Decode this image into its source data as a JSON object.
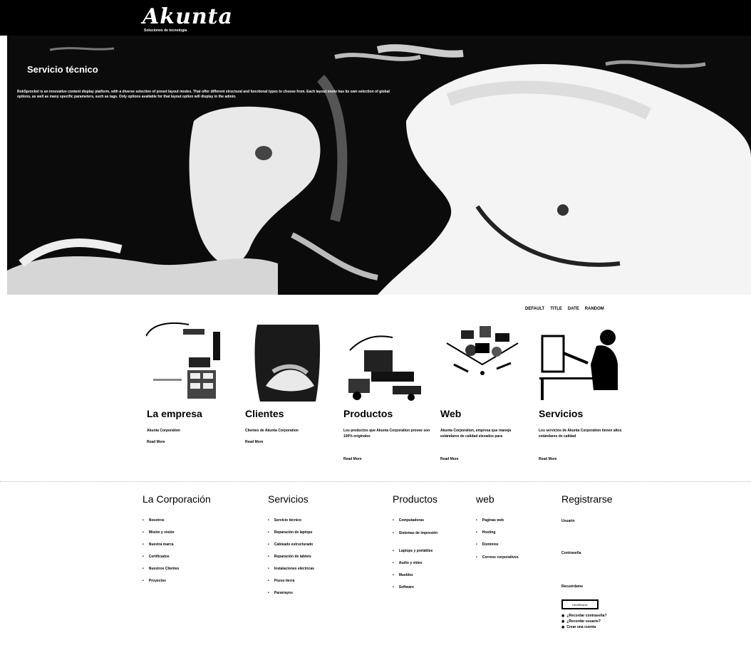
{
  "header": {
    "logo_text": "Akunta",
    "tagline": "Soluciones de tecnología"
  },
  "hero": {
    "title": "Servicio técnico",
    "text": "RokSprocket is an innovative content display platform, with a diverse selection of preset layout modes. That offer different structural and functional types to choose from. Each layout mode has its own selection of global options, as well as many specific parameters, such as tags. Only options available for that layout option will display in the admin."
  },
  "layout_switch": [
    "DEFAULT",
    "TITLE",
    "DATE",
    "RANDOM"
  ],
  "features": [
    {
      "title": "La empresa",
      "desc": "Akunta Corporation",
      "more": "Read More"
    },
    {
      "title": "Clientes",
      "desc": "Clientes de Akunta Corporation",
      "more": "Read More"
    },
    {
      "title": "Productos",
      "desc": "Los productos que Akunta Corporation provee son 100% originales",
      "more": "Read More"
    },
    {
      "title": "Web",
      "desc": "Akunta Corporation, empresa que maneja estándares de calidad elevados para",
      "more": "Read More"
    },
    {
      "title": "Servicios",
      "desc": "Los servicios de Akunta Corporation tienen altos estándares de calidad",
      "more": "Read More"
    }
  ],
  "footer": {
    "corporacion": {
      "title": "La Corporación",
      "items": [
        "Nosotros",
        "Misión y visión",
        "Nuestra marca",
        "Certificados",
        "Nuestros Clientes",
        "Proyectos"
      ]
    },
    "servicios": {
      "title": "Servicios",
      "items": [
        "Servicio técnico",
        "Reparación de laptops",
        "Cableado estructurado",
        "Reparación de tablets",
        "Instalaciones eléctricas",
        "Pozos tierra",
        "Pararrayos"
      ]
    },
    "productos": {
      "title": "Productos",
      "items": [
        "Computadoras",
        "Sistemas de impresión",
        "Laptops y portátiles",
        "Audio y video",
        "Muebles",
        "Software"
      ]
    },
    "web": {
      "title": "web",
      "items": [
        "Paginas web",
        "Hosting",
        "Dominios",
        "Correos corporativos"
      ]
    },
    "registrarse": {
      "title": "Registrarse",
      "user_label": "Usuario",
      "pass_label": "Contraseña",
      "remember_label": "Recuérdame",
      "button_label": "Identificarse",
      "links": [
        "¿Recordar contraseña?",
        "¿Recordar usuario?",
        "Crear una cuenta"
      ]
    }
  }
}
